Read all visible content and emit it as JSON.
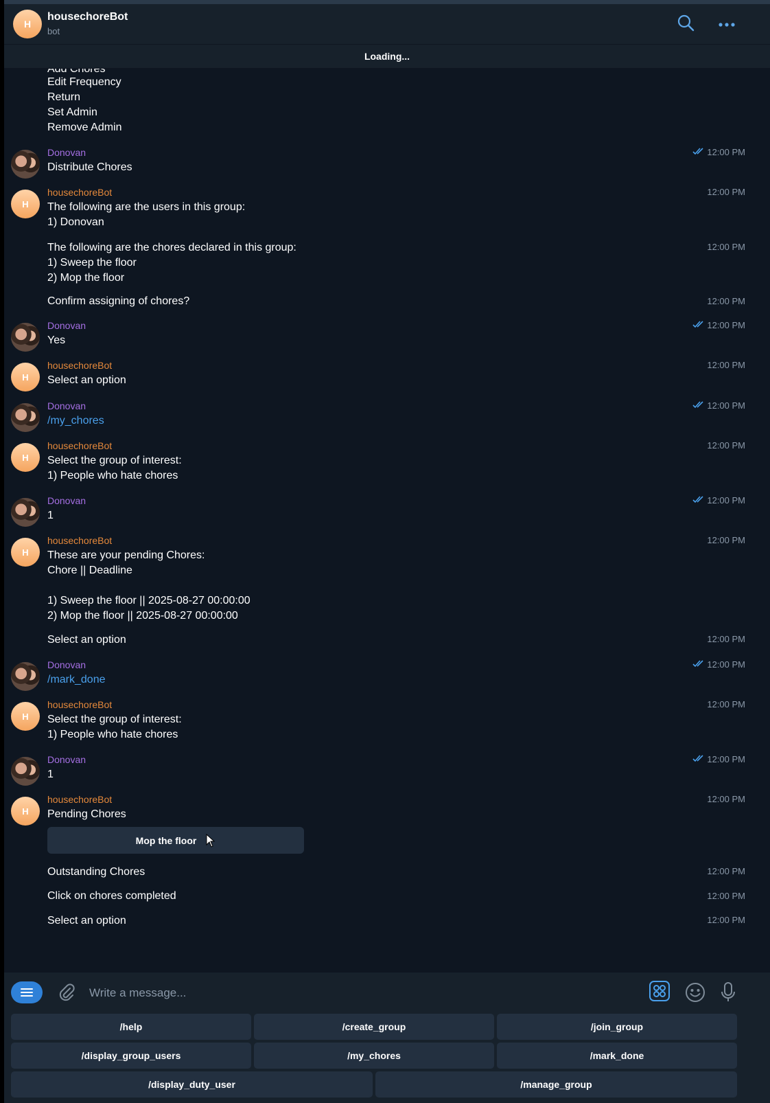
{
  "header": {
    "avatar_initial": "H",
    "title": "housechoreBot",
    "subtitle": "bot",
    "icons": [
      "search-icon",
      "more-icon"
    ]
  },
  "status": {
    "loading_text": "Loading..."
  },
  "chat": {
    "cut_top_line": "Add Chores",
    "top_menu_lines": [
      "Edit Frequency",
      "Return",
      "Set Admin",
      "Remove Admin"
    ],
    "user_name": "Donovan",
    "bot_name": "housechoreBot",
    "bot_avatar_initial": "H",
    "time": "12:00 PM",
    "messages": {
      "m1": "Distribute Chores",
      "m2": "The following are the users in this group:\n1) Donovan",
      "m3": "The following are the chores declared in this group:\n1) Sweep the floor\n2) Mop the floor",
      "m4": "Confirm assigning of chores?",
      "m5": "Yes",
      "m6": "Select an option",
      "m7": "/my_chores",
      "m8": "Select the group of interest:\n1) People who hate chores",
      "m9": "1",
      "m10": "These are your pending Chores:\nChore || Deadline\n\n1) Sweep the floor || 2025-08-27 00:00:00\n2) Mop the floor || 2025-08-27 00:00:00",
      "m11": "Select an option",
      "m12": "/mark_done",
      "m13": "Select the group of interest:\n1) People who hate chores",
      "m14": "1",
      "m15": "Pending Chores",
      "inline_button": "Mop the floor",
      "m16": "Outstanding Chores",
      "m17": "Click on chores completed",
      "m18": "Select an option"
    }
  },
  "input": {
    "placeholder": "Write a message...",
    "icons": [
      "menu-icon",
      "paperclip-icon",
      "commands-icon",
      "emoji-icon",
      "microphone-icon"
    ]
  },
  "keyboard": {
    "buttons": [
      "/help",
      "/create_group",
      "/join_group",
      "/display_group_users",
      "/my_chores",
      "/mark_done",
      "/display_duty_user",
      "/manage_group"
    ]
  },
  "colors": {
    "chat_bg": "#0e1621",
    "panel_bg": "#17212b",
    "button_bg": "#233040",
    "user_name": "#a56fe3",
    "bot_name": "#e5893b",
    "link": "#4aa0ec",
    "accent": "#2f81d8"
  }
}
